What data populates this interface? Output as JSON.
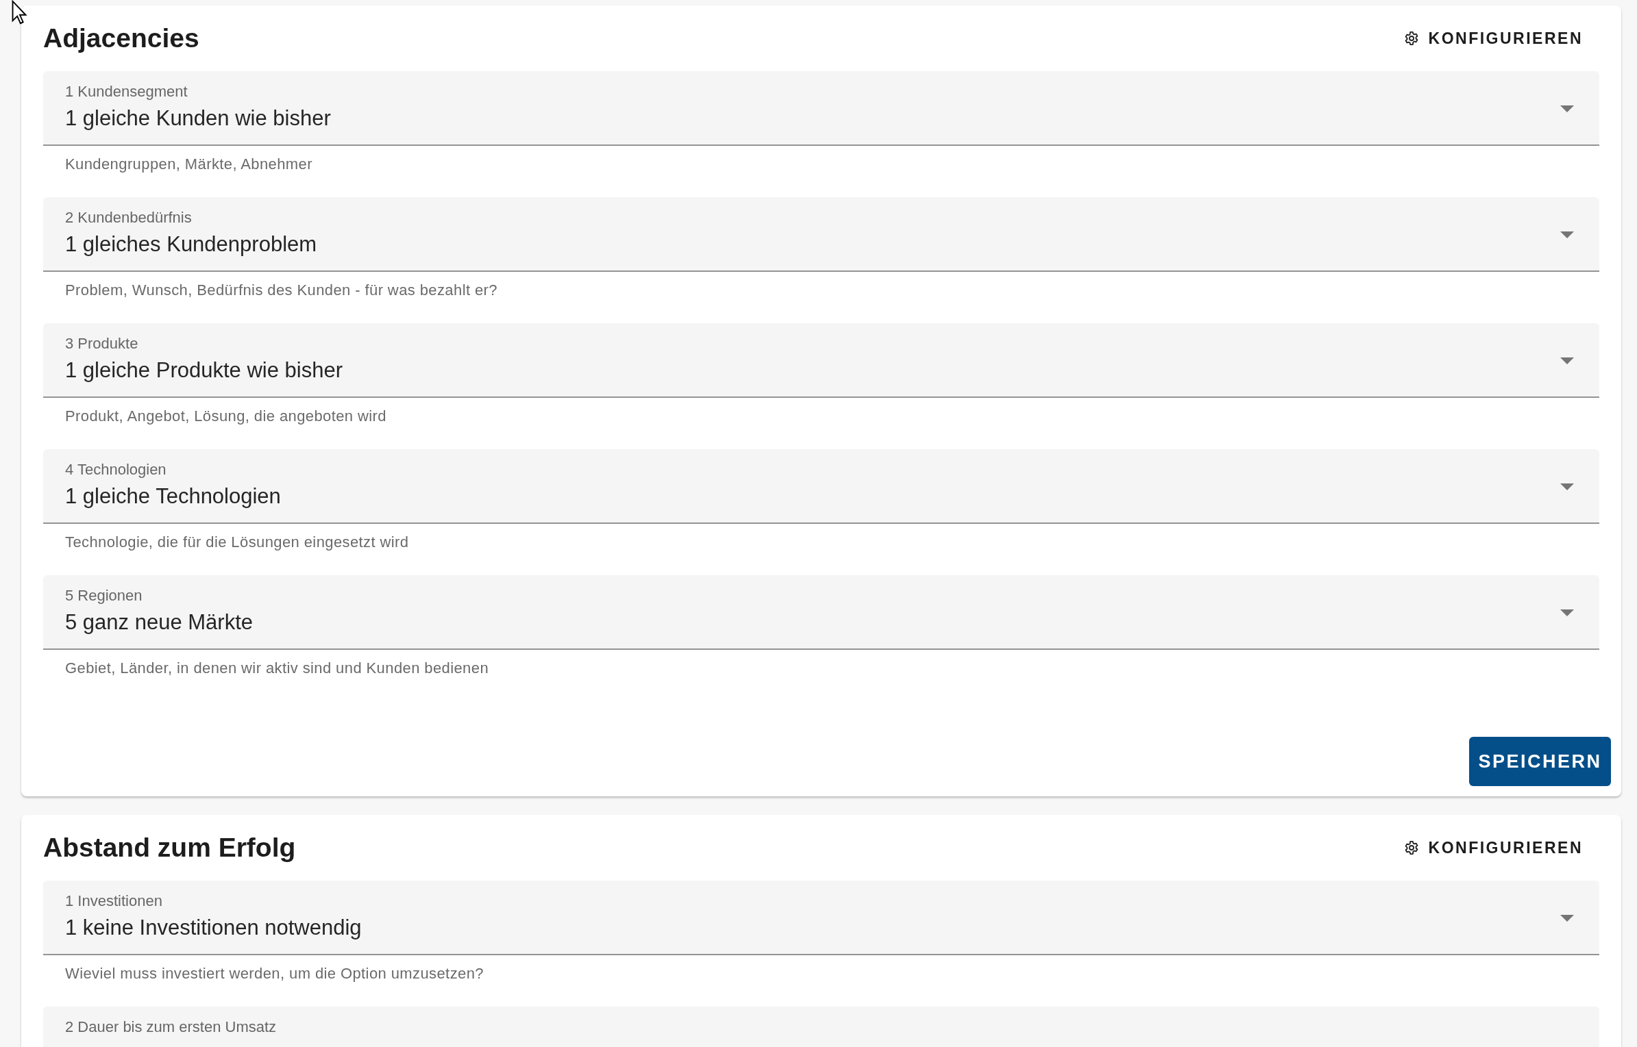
{
  "cards": [
    {
      "title": "Adjacencies",
      "configure_button": "KONFIGURIEREN",
      "fields": [
        {
          "label": "1 Kundensegment",
          "value": "1 gleiche Kunden wie bisher",
          "hint": "Kundengruppen, Märkte, Abnehmer"
        },
        {
          "label": "2 Kundenbedürfnis",
          "value": "1 gleiches Kundenproblem",
          "hint": "Problem, Wunsch, Bedürfnis des Kunden - für was bezahlt er?"
        },
        {
          "label": "3 Produkte",
          "value": "1 gleiche Produkte wie bisher",
          "hint": "Produkt, Angebot, Lösung, die angeboten wird"
        },
        {
          "label": "4 Technologien",
          "value": "1 gleiche Technologien",
          "hint": "Technologie, die für die Lösungen eingesetzt wird"
        },
        {
          "label": "5 Regionen",
          "value": "5 ganz neue Märkte",
          "hint": "Gebiet, Länder, in denen wir aktiv sind und Kunden bedienen"
        }
      ],
      "save_button": "SPEICHERN"
    },
    {
      "title": "Abstand zum Erfolg",
      "configure_button": "KONFIGURIEREN",
      "fields": [
        {
          "label": "1 Investitionen",
          "value": "1 keine Investitionen notwendig",
          "hint": "Wieviel muss investiert werden, um die Option umzusetzen?"
        },
        {
          "label": "2 Dauer bis zum ersten Umsatz"
        }
      ]
    }
  ]
}
